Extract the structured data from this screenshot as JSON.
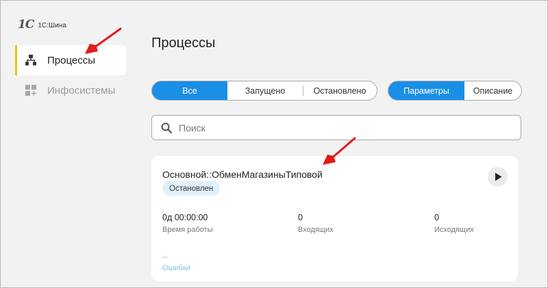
{
  "app": {
    "logo_mark": "1С",
    "logo_text": "1С:Шина"
  },
  "sidebar": {
    "items": [
      {
        "label": "Процессы",
        "icon": "hierarchy-icon",
        "active": true
      },
      {
        "label": "Инфосистемы",
        "icon": "add-grid-icon",
        "active": false
      }
    ]
  },
  "main": {
    "title": "Процессы",
    "status_filter": {
      "options": [
        "Все",
        "Запущено",
        "Остановлено"
      ],
      "selected": "Все"
    },
    "view_toggle": {
      "options": [
        "Параметры",
        "Описание"
      ],
      "selected": "Параметры"
    },
    "search": {
      "placeholder": "Поиск",
      "value": ""
    },
    "card": {
      "title": "Основной::ОбменМагазиныТиповой",
      "status": "Остановлен",
      "stats": [
        {
          "value": "0д 00:00:00",
          "caption": "Время работы"
        },
        {
          "value": "0",
          "caption": "Входящих"
        },
        {
          "value": "0",
          "caption": "Исходящих"
        }
      ],
      "errors": {
        "value": "--",
        "caption": "Ошибки"
      }
    }
  },
  "colors": {
    "accent": "#1a8fe6",
    "active_marker": "#f2c200",
    "annotation_arrow": "#e31b1b"
  }
}
